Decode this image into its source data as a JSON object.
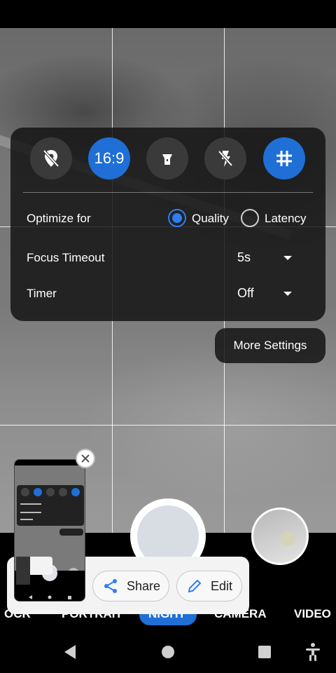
{
  "quick_settings": {
    "buttons": [
      {
        "name": "hdr-off",
        "icon": "hdr-off-icon",
        "active": false
      },
      {
        "name": "aspect-ratio",
        "label": "16:9",
        "active": true
      },
      {
        "name": "torch",
        "icon": "flashlight-icon",
        "active": false
      },
      {
        "name": "flash-off",
        "icon": "flash-off-icon",
        "active": false
      },
      {
        "name": "grid",
        "icon": "grid-icon",
        "active": true
      }
    ],
    "optimize_label": "Optimize for",
    "quality_label": "Quality",
    "latency_label": "Latency",
    "optimize_selected": "Quality",
    "focus_timeout_label": "Focus Timeout",
    "focus_timeout_value": "5s",
    "timer_label": "Timer",
    "timer_value": "Off"
  },
  "more_settings_label": "More Settings",
  "modes": [
    "OCR",
    "PORTRAIT",
    "NIGHT",
    "CAMERA",
    "VIDEO"
  ],
  "active_mode": "NIGHT",
  "share_sheet": {
    "share_label": "Share",
    "edit_label": "Edit"
  },
  "colors": {
    "accent": "#1f6fd6",
    "panel": "#141414",
    "radio": "#2f7df0"
  }
}
